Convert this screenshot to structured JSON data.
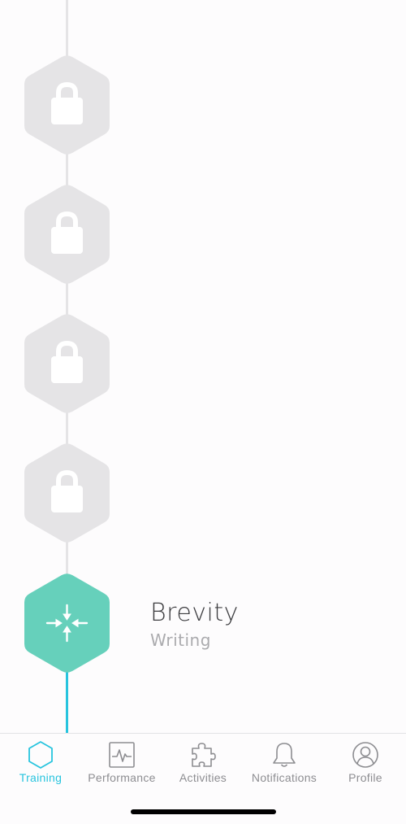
{
  "timeline": {
    "locked_levels": [
      {
        "state": "locked",
        "icon": "lock-icon"
      },
      {
        "state": "locked",
        "icon": "lock-icon"
      },
      {
        "state": "locked",
        "icon": "lock-icon"
      },
      {
        "state": "locked",
        "icon": "lock-icon"
      }
    ],
    "current_level": {
      "title": "Brevity",
      "category": "Writing",
      "icon": "compress-arrows-icon",
      "color": "#66d0bb"
    },
    "colors": {
      "locked_hex": "#e5e4e6",
      "connector": "#e5e4e6",
      "active_connector": "#27c4de"
    }
  },
  "tabbar": {
    "selected": "Training",
    "accent": "#27c4de",
    "tabs": [
      {
        "label": "Training",
        "icon": "hexagon-icon"
      },
      {
        "label": "Performance",
        "icon": "pulse-chart-icon"
      },
      {
        "label": "Activities",
        "icon": "puzzle-piece-icon"
      },
      {
        "label": "Notifications",
        "icon": "bell-icon"
      },
      {
        "label": "Profile",
        "icon": "user-circle-icon"
      }
    ]
  }
}
